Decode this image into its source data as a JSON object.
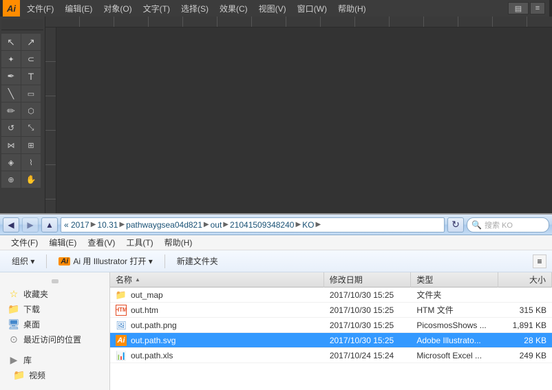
{
  "ai_app": {
    "logo": "Ai",
    "menubar": [
      {
        "label": "文件(F)"
      },
      {
        "label": "编辑(E)"
      },
      {
        "label": "对象(O)"
      },
      {
        "label": "文字(T)"
      },
      {
        "label": "选择(S)"
      },
      {
        "label": "效果(C)"
      },
      {
        "label": "视图(V)"
      },
      {
        "label": "窗口(W)"
      },
      {
        "label": "帮助(H)"
      }
    ],
    "tools": [
      {
        "name": "selection-tool",
        "icon": "↖",
        "row": 0
      },
      {
        "name": "direct-selection-tool",
        "icon": "↗",
        "row": 0
      },
      {
        "name": "magic-wand-tool",
        "icon": "✦",
        "row": 1
      },
      {
        "name": "lasso-tool",
        "icon": "⟳",
        "row": 1
      },
      {
        "name": "pen-tool",
        "icon": "✒",
        "row": 2
      },
      {
        "name": "text-tool",
        "icon": "T",
        "row": 2
      },
      {
        "name": "line-tool",
        "icon": "╱",
        "row": 3
      },
      {
        "name": "rectangle-tool",
        "icon": "▭",
        "row": 3
      },
      {
        "name": "pencil-tool",
        "icon": "✏",
        "row": 4
      },
      {
        "name": "eraser-tool",
        "icon": "◻",
        "row": 4
      },
      {
        "name": "rotate-tool",
        "icon": "↺",
        "row": 5
      },
      {
        "name": "scale-tool",
        "icon": "⤡",
        "row": 5
      },
      {
        "name": "blend-tool",
        "icon": "⋈",
        "row": 6
      },
      {
        "name": "mesh-tool",
        "icon": "⊞",
        "row": 6
      },
      {
        "name": "gradient-tool",
        "icon": "◈",
        "row": 7
      },
      {
        "name": "eyedropper-tool",
        "icon": "⌇",
        "row": 7
      },
      {
        "name": "zoom-tool",
        "icon": "⊕",
        "row": 8
      },
      {
        "name": "hand-tool",
        "icon": "✋",
        "row": 8
      }
    ]
  },
  "explorer": {
    "title": "KO",
    "address": {
      "segments": [
        "« 2017",
        "10.31",
        "pathwaygsea04d821",
        "out",
        "21041509348240",
        "KO"
      ]
    },
    "search_placeholder": "搜索 KO",
    "menubar": [
      {
        "label": "文件(F)"
      },
      {
        "label": "编辑(E)"
      },
      {
        "label": "查看(V)"
      },
      {
        "label": "工具(T)"
      },
      {
        "label": "帮助(H)"
      }
    ],
    "toolbar": [
      {
        "label": "组织 ▾",
        "name": "organize-button"
      },
      {
        "label": "Ai 用 Illustrator 打开 ▾",
        "name": "open-in-illustrator-button"
      },
      {
        "label": "新建文件夹",
        "name": "new-folder-button"
      }
    ],
    "sidebar": {
      "items": [
        {
          "icon": "star",
          "label": "收藏夹",
          "type": "section"
        },
        {
          "icon": "folder",
          "label": "下载"
        },
        {
          "icon": "monitor",
          "label": "桌面"
        },
        {
          "icon": "recent",
          "label": "最近访问的位置"
        },
        {
          "icon": "library",
          "label": "库",
          "type": "section"
        },
        {
          "icon": "video-folder",
          "label": "视频"
        }
      ]
    },
    "columns": [
      {
        "label": "名称",
        "sort": "asc"
      },
      {
        "label": "修改日期"
      },
      {
        "label": "类型"
      },
      {
        "label": "大小"
      }
    ],
    "files": [
      {
        "name": "out_map",
        "date": "2017/10/30 15:25",
        "type": "文件夹",
        "size": "",
        "icon": "folder",
        "selected": false
      },
      {
        "name": "out.htm",
        "date": "2017/10/30 15:25",
        "type": "HTM 文件",
        "size": "315 KB",
        "icon": "html",
        "selected": false
      },
      {
        "name": "out.path.png",
        "date": "2017/10/30 15:25",
        "type": "PicosmosShows ...",
        "size": "1,891 KB",
        "icon": "png",
        "selected": false
      },
      {
        "name": "out.path.svg",
        "date": "2017/10/30 15:25",
        "type": "Adobe Illustrato...",
        "size": "28 KB",
        "icon": "svg",
        "selected": true
      },
      {
        "name": "out.path.xls",
        "date": "2017/10/24 15:24",
        "type": "Microsoft Excel ...",
        "size": "249 KB",
        "icon": "xls",
        "selected": false
      }
    ]
  }
}
